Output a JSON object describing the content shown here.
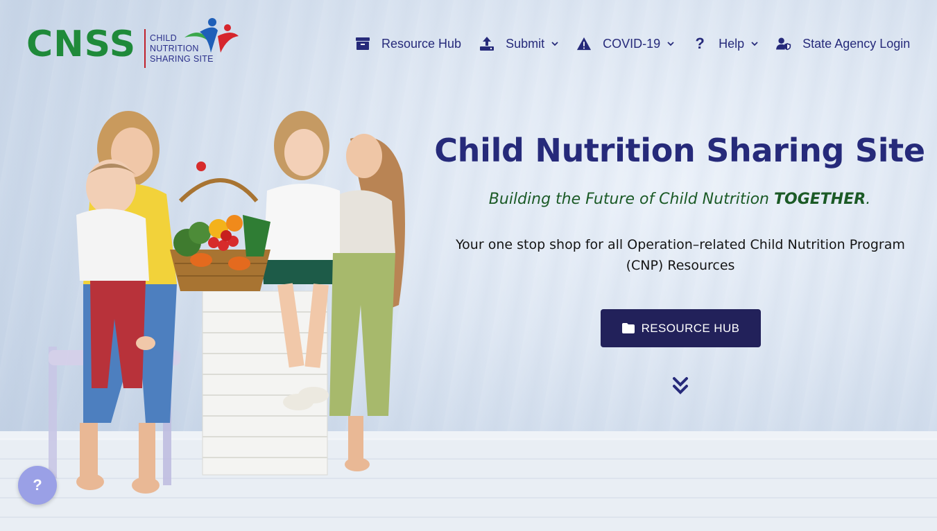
{
  "logo": {
    "wordmark": "CNSS",
    "subtitle_lines": [
      "CHILD",
      "NUTRITION",
      "SHARING SITE"
    ],
    "colors": {
      "wordmark": "#1f8a3a",
      "divider": "#c0202a",
      "subtitle": "#2a2f8a"
    }
  },
  "nav": {
    "items": [
      {
        "label": "Resource Hub",
        "icon": "archive-box-icon",
        "dropdown": false
      },
      {
        "label": "Submit",
        "icon": "upload-icon",
        "dropdown": true
      },
      {
        "label": "COVID-19",
        "icon": "warning-triangle-icon",
        "dropdown": true
      },
      {
        "label": "Help",
        "icon": "question-mark-icon",
        "dropdown": true
      },
      {
        "label": "State Agency Login",
        "icon": "user-shield-icon",
        "dropdown": false
      }
    ],
    "color": "#262a7a"
  },
  "hero": {
    "title": "Child Nutrition Sharing Site",
    "tagline_prefix": "Building the Future of Child Nutrition ",
    "tagline_emphasis": "TOGETHER",
    "tagline_suffix": ".",
    "description": "Your one stop shop for all Operation–related Child Nutrition Program (CNP) Resources",
    "cta_label": "RESOURCE HUB",
    "cta_icon": "folder-icon",
    "scroll_icon": "double-chevron-down-icon",
    "colors": {
      "title": "#262a7a",
      "tagline": "#1b5a26",
      "cta_bg": "#22215a"
    }
  },
  "help_fab": {
    "label": "?",
    "color": "#9aa0e6"
  }
}
